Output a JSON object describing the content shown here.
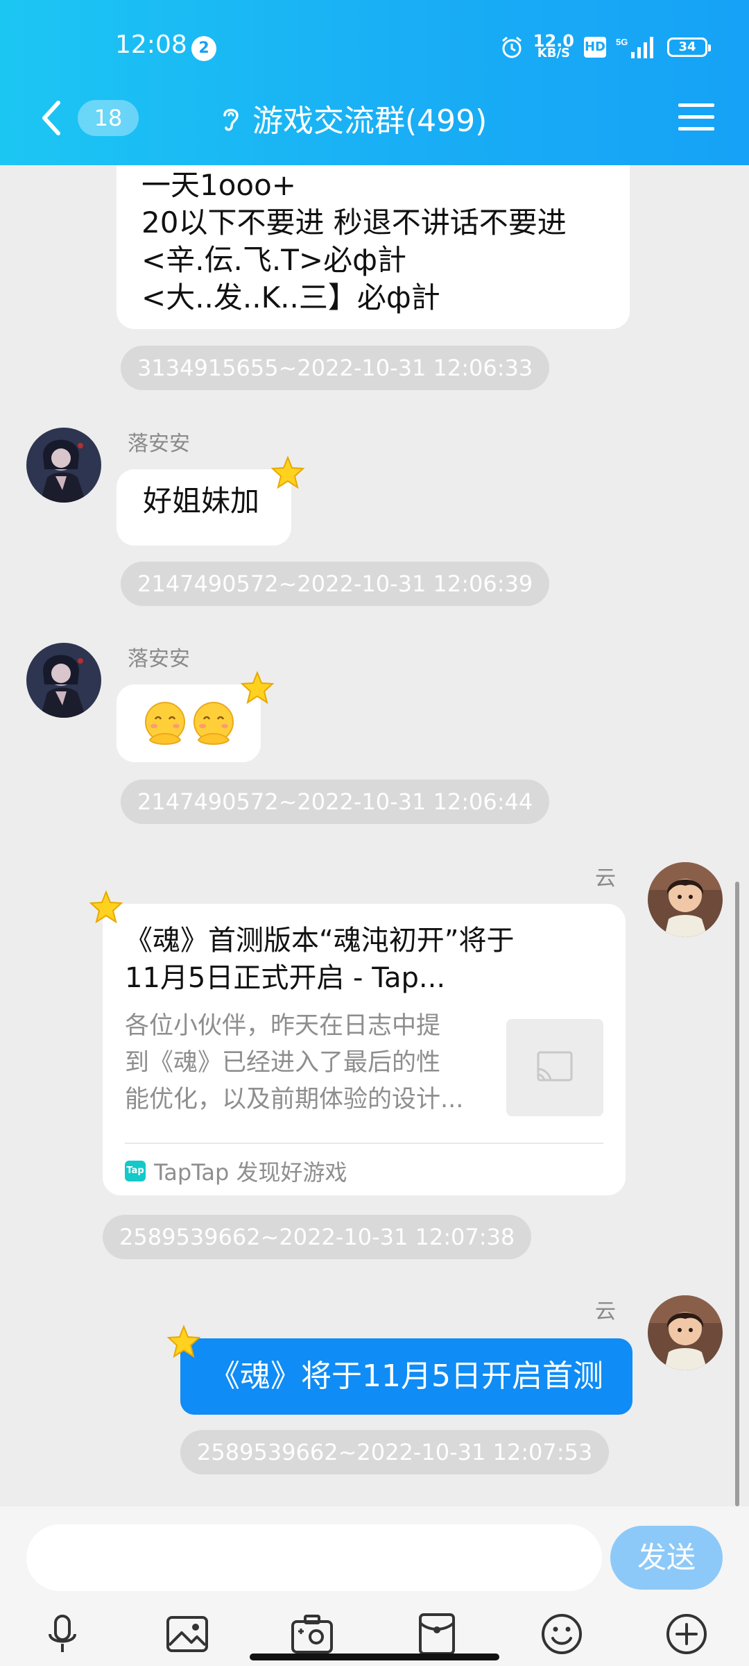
{
  "status_bar": {
    "time": "12:08",
    "notification_count": "2",
    "net_speed_value": "12.0",
    "net_speed_unit": "KB/S",
    "hd": "HD",
    "network": "5G",
    "battery": "34"
  },
  "header": {
    "unread_count": "18",
    "title": "游戏交流群(499)"
  },
  "messages": [
    {
      "type": "text",
      "lines": [
        "一天1ooo+",
        "20以下不要进 秒退不讲话不要进",
        "<辛.伝.飞.T>必ф計",
        "<大..发..K..三】必ф計"
      ],
      "timestamp": "3134915655~2022-10-31 12:06:33"
    },
    {
      "type": "text",
      "nickname": "落安安",
      "text": "好姐妹加",
      "timestamp": "2147490572~2022-10-31 12:06:39"
    },
    {
      "type": "emoji",
      "nickname": "落安安",
      "timestamp": "2147490572~2022-10-31 12:06:44"
    },
    {
      "type": "link_card",
      "nickname": "云",
      "card_title_line1": "《魂》首测版本“魂沌初开”将于",
      "card_title_line2": "11月5日正式开启 - Tap...",
      "card_desc_line1": "各位小伙伴，昨天在日志中提",
      "card_desc_line2": "到《魂》已经进入了最后的性",
      "card_desc_line3": "能优化，以及前期体验的设计...",
      "source_logo": "Tap",
      "source": "TapTap 发现好游戏",
      "timestamp": "2589539662~2022-10-31 12:07:38"
    },
    {
      "type": "text",
      "nickname": "云",
      "text": "《魂》将于11月5日开启首测",
      "timestamp": "2589539662~2022-10-31 12:07:53"
    }
  ],
  "input_bar": {
    "placeholder": "",
    "send_label": "发送"
  },
  "toolbar": {
    "icons": [
      "microphone-icon",
      "image-icon",
      "camera-icon",
      "red-packet-icon",
      "emoji-icon",
      "plus-icon"
    ]
  },
  "colors": {
    "header_gradient_start": "#1cc6f3",
    "header_gradient_end": "#16a2f6",
    "self_bubble": "#0f8cf5",
    "send_button": "#8cc9f8",
    "chat_background": "#ededed"
  }
}
